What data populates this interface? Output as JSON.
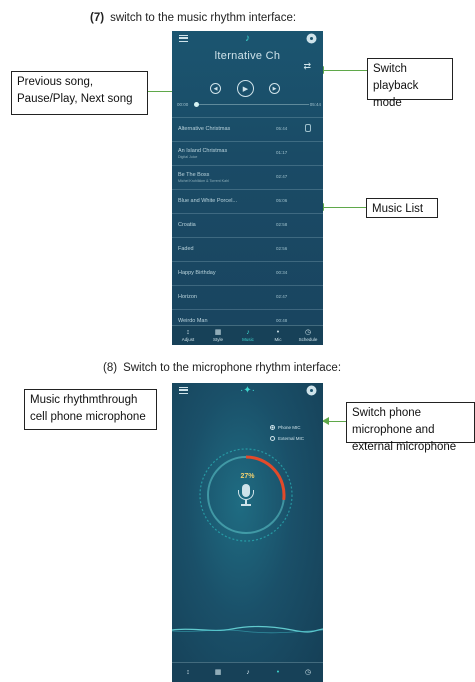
{
  "section7": {
    "number": "(7)",
    "text": "switch to the music rhythm interface:"
  },
  "section8": {
    "number": "(8)",
    "text": "Switch to the microphone rhythm interface:"
  },
  "callouts": {
    "prev_pause_next": "Previous song, Pause/Play, Next song",
    "switch_playback": "Switch playback mode",
    "music_list": "Music List",
    "music_rhythm_mic": "Music rhythmthrough cell phone microphone",
    "switch_mic": "Switch phone microphone and external microphone"
  },
  "music_screen": {
    "title": "lternative Ch",
    "time_start": "00:00",
    "time_end": "05:44",
    "progress": 0.0,
    "songs": [
      {
        "name": "Alternative Christmas",
        "duration": "05:44",
        "sub": ""
      },
      {
        "name": "An Island Christmas",
        "duration": "01:17",
        "sub": "Digital Juice"
      },
      {
        "name": "Be The Boss",
        "duration": "02:47",
        "sub": "Michel Krohlikkm & Torrent Kahl"
      },
      {
        "name": "Blue and White Porcel...",
        "duration": "05:06",
        "sub": ""
      },
      {
        "name": "Croatia",
        "duration": "02:58",
        "sub": ""
      },
      {
        "name": "Faded",
        "duration": "02:56",
        "sub": ""
      },
      {
        "name": "Happy Birthday",
        "duration": "00:34",
        "sub": ""
      },
      {
        "name": "Horizon",
        "duration": "02:47",
        "sub": ""
      },
      {
        "name": "Weirdo Man",
        "duration": "00:48",
        "sub": ""
      }
    ],
    "tabs": [
      {
        "label": "Adjust",
        "icon": "sliders-icon",
        "glyph": "↕"
      },
      {
        "label": "Style",
        "icon": "grid-icon",
        "glyph": "▦"
      },
      {
        "label": "Music",
        "icon": "music-note-icon",
        "glyph": "♪"
      },
      {
        "label": "Mic",
        "icon": "mic-wave-icon",
        "glyph": "•"
      },
      {
        "label": "Schedule",
        "icon": "clock-icon",
        "glyph": "◷"
      }
    ],
    "accent": "#3fd8d0"
  },
  "mic_screen": {
    "options": [
      {
        "label": "Phone MIC",
        "selected": true
      },
      {
        "label": "External MIC",
        "selected": false
      }
    ],
    "level_percent": "27%",
    "level": 0.27,
    "accent": "#e24a2a"
  }
}
